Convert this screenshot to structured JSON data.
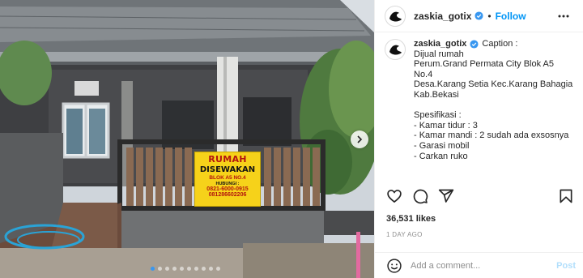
{
  "user": {
    "username": "zaskia_gotix",
    "follow_label": "Follow",
    "separator": "•"
  },
  "caption": {
    "username": "zaskia_gotix",
    "heading": "Caption :",
    "lines": [
      "Dijual rumah",
      "Perum.Grand Permata City Blok A5",
      "No.4",
      "Desa.Karang Setia Kec.Karang Bahagia",
      "Kab.Bekasi",
      "",
      "Spesifikasi :",
      "- Kamar tidur : 3",
      "- Kamar mandi : 2 sudah ada exsosnya",
      "- Garasi mobil",
      "- Carkan ruko"
    ]
  },
  "photo": {
    "sign": {
      "line1": "RUMAH",
      "line2": "DISEWAKAN",
      "line3": "BLOK A5 NO.4",
      "line4": "HUBUNGI :",
      "line5": "0821-6000-0915",
      "line6": "081286602206"
    },
    "carousel": {
      "total": 10,
      "active_index": 0
    }
  },
  "stats": {
    "likes": "36,531 likes",
    "time_ago": "1 DAY AGO"
  },
  "comment": {
    "placeholder": "Add a comment...",
    "post_label": "Post"
  },
  "icons": {
    "verified": "verified-badge-icon",
    "more": "more-options-icon",
    "like": "heart-icon",
    "comment": "comment-icon",
    "share": "send-icon",
    "save": "bookmark-icon",
    "emoji": "emoji-icon",
    "next": "chevron-right-icon"
  },
  "colors": {
    "accent": "#0095f6",
    "verified": "#3897f0",
    "sign_yellow": "#f6d21a",
    "sign_red": "#b3150f"
  }
}
